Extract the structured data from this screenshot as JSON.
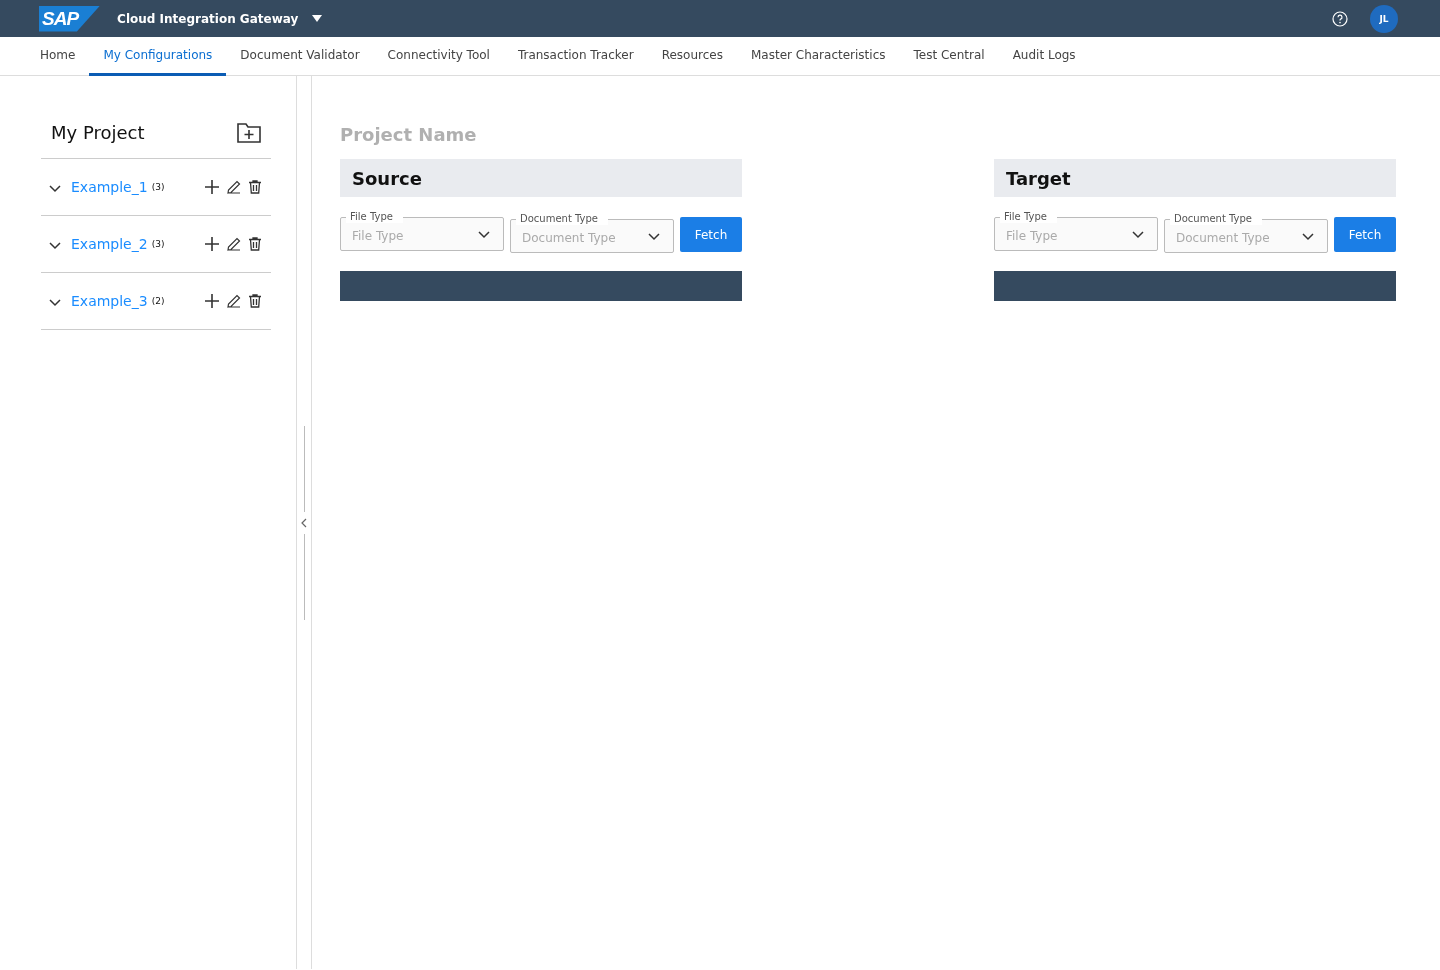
{
  "header": {
    "logo": "SAP",
    "title": "Cloud Integration Gateway",
    "avatar": "JL"
  },
  "tabs": [
    {
      "label": "Home",
      "selected": false
    },
    {
      "label": "My Configurations",
      "selected": true
    },
    {
      "label": "Document Validator",
      "selected": false
    },
    {
      "label": "Connectivity Tool",
      "selected": false
    },
    {
      "label": "Transaction Tracker",
      "selected": false
    },
    {
      "label": "Resources",
      "selected": false
    },
    {
      "label": "Master Characteristics",
      "selected": false
    },
    {
      "label": "Test Central",
      "selected": false
    },
    {
      "label": "Audit Logs",
      "selected": false
    }
  ],
  "sidebar": {
    "title": "My Project",
    "items": [
      {
        "name": "Example_1",
        "count": "(3)",
        "expanded": false
      },
      {
        "name": "Example_2",
        "count": "(3)",
        "expanded": false
      },
      {
        "name": "Example_3",
        "count": "(2)",
        "expanded": false
      }
    ]
  },
  "content": {
    "project_name": "Project Name",
    "panels": [
      {
        "title": "Source",
        "fields": [
          {
            "label": "File Type",
            "placeholder": "File Type"
          },
          {
            "label": "Document Type",
            "placeholder": "Document Type"
          }
        ],
        "button": "Fetch"
      },
      {
        "title": "Target",
        "fields": [
          {
            "label": "File Type",
            "placeholder": "File Type"
          },
          {
            "label": "Document Type",
            "placeholder": "Document Type"
          }
        ],
        "button": "Fetch"
      }
    ]
  }
}
